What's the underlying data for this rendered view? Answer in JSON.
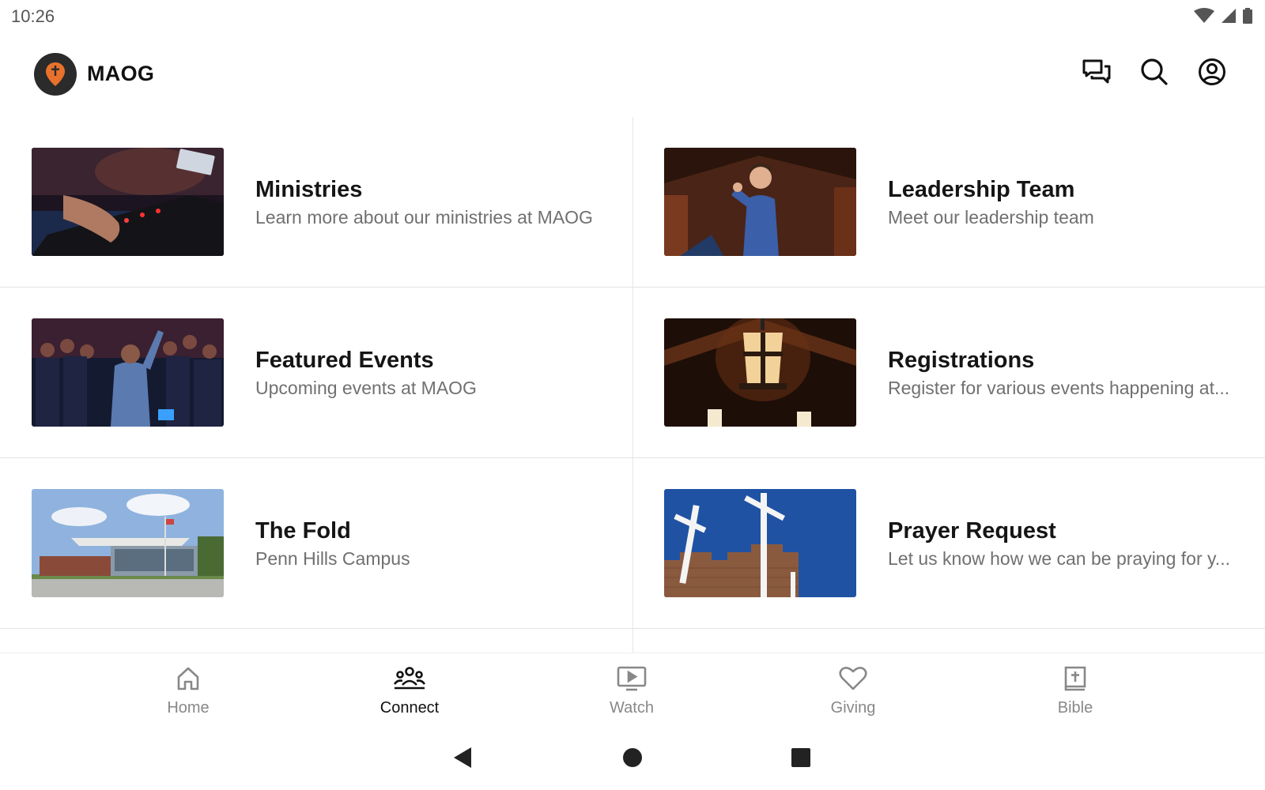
{
  "status_bar": {
    "time": "10:26",
    "icons": [
      "wifi-icon",
      "cell-signal-icon",
      "battery-icon"
    ]
  },
  "app_bar": {
    "title": "MAOG",
    "logo_icon": "location-pin-cross-icon",
    "actions": [
      "chat-icon",
      "search-icon",
      "account-icon"
    ]
  },
  "cards": [
    {
      "title": "Ministries",
      "subtitle": "Learn more about our ministries at MAOG",
      "image": "keyboard-player-photo"
    },
    {
      "title": "Leadership Team",
      "subtitle": "Meet our leadership team",
      "image": "pastor-speaking-photo"
    },
    {
      "title": "Featured Events",
      "subtitle": "Upcoming events at MAOG",
      "image": "worship-crowd-photo"
    },
    {
      "title": "Registrations",
      "subtitle": "Register for various events happening at...",
      "image": "church-lantern-photo"
    },
    {
      "title": "The Fold",
      "subtitle": "Penn Hills Campus",
      "image": "campus-building-photo"
    },
    {
      "title": "Prayer Request",
      "subtitle": "Let us know how we can be praying for y...",
      "image": "crosses-sky-photo"
    }
  ],
  "bottom_nav": {
    "items": [
      {
        "label": "Home",
        "icon": "home-icon",
        "active": false
      },
      {
        "label": "Connect",
        "icon": "people-group-icon",
        "active": true
      },
      {
        "label": "Watch",
        "icon": "tv-play-icon",
        "active": false
      },
      {
        "label": "Giving",
        "icon": "heart-icon",
        "active": false
      },
      {
        "label": "Bible",
        "icon": "bible-icon",
        "active": false
      }
    ]
  },
  "system_nav": [
    "back-icon",
    "home-circle-icon",
    "recents-square-icon"
  ],
  "colors": {
    "accent_orange": "#e8712b",
    "text_primary": "#151515",
    "text_secondary": "#707070",
    "nav_inactive": "#888888"
  }
}
